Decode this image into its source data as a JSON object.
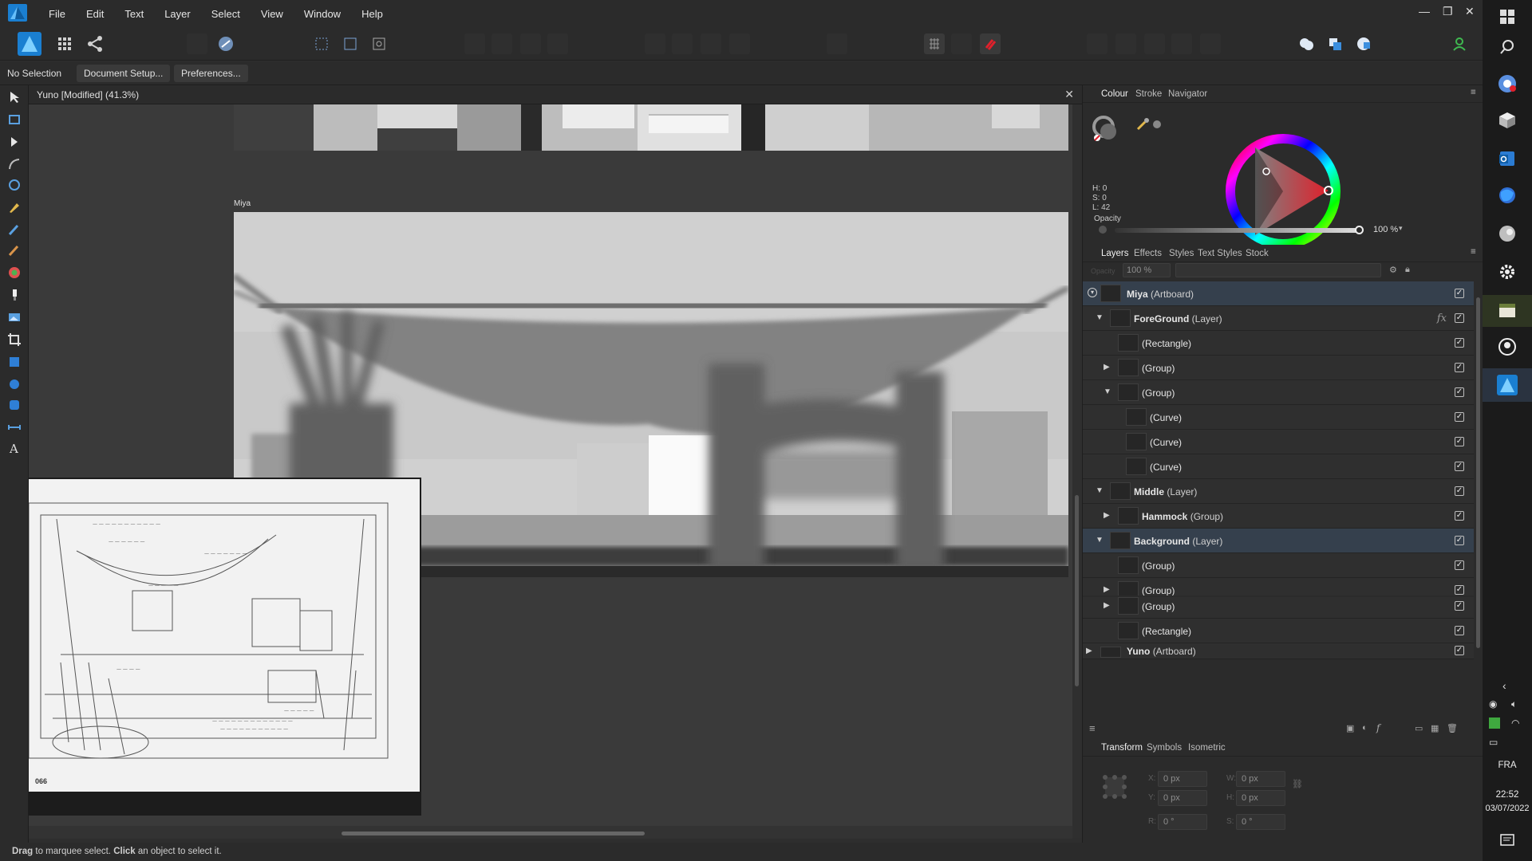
{
  "menubar": {
    "items": [
      "File",
      "Edit",
      "Text",
      "Layer",
      "Select",
      "View",
      "Window",
      "Help"
    ]
  },
  "contextbar": {
    "selection": "No Selection",
    "document_setup": "Document Setup...",
    "preferences": "Preferences..."
  },
  "document": {
    "tab_title": "Yuno [Modified] (41.3%)",
    "artboard_label": "Miya"
  },
  "colour_panel": {
    "tabs": [
      "Colour",
      "Stroke",
      "Navigator"
    ],
    "h": "H: 0",
    "s": "S: 0",
    "l": "L: 42",
    "opacity_label": "Opacity",
    "opacity_value": "100 %",
    "accent": "#e0202b"
  },
  "layers_panel": {
    "tabs": [
      "Layers",
      "Effects",
      "Styles",
      "Text Styles",
      "Stock"
    ],
    "opacity_label": "Opacity",
    "opacity_value": "100 %",
    "rows": [
      {
        "name": "Miya",
        "type": "(Artboard)"
      },
      {
        "name": "ForeGround",
        "type": "(Layer)"
      },
      {
        "name": "",
        "type": "(Rectangle)"
      },
      {
        "name": "",
        "type": "(Group)"
      },
      {
        "name": "",
        "type": "(Group)"
      },
      {
        "name": "",
        "type": "(Curve)"
      },
      {
        "name": "",
        "type": "(Curve)"
      },
      {
        "name": "",
        "type": "(Curve)"
      },
      {
        "name": "Middle",
        "type": "(Layer)"
      },
      {
        "name": "Hammock",
        "type": "(Group)"
      },
      {
        "name": "Background",
        "type": "(Layer)"
      },
      {
        "name": "",
        "type": "(Group)"
      },
      {
        "name": "",
        "type": "(Group)"
      },
      {
        "name": "",
        "type": "(Group)"
      },
      {
        "name": "",
        "type": "(Rectangle)"
      },
      {
        "name": "Yuno",
        "type": "(Artboard)"
      }
    ],
    "fx": "fx"
  },
  "transform_panel": {
    "tabs": [
      "Transform",
      "Symbols",
      "Isometric"
    ],
    "x_label": "X:",
    "x": "0 px",
    "y_label": "Y:",
    "y": "0 px",
    "w_label": "W:",
    "w": "0 px",
    "h_label": "H:",
    "h": "0 px",
    "r_label": "R:",
    "r": "0 °",
    "s_label": "S:",
    "s": "0 °"
  },
  "sketch": {
    "page_number": "066"
  },
  "statusbar": {
    "drag": "Drag",
    "text1": " to marquee select. ",
    "click": "Click",
    "text2": " an object to select it."
  },
  "taskbar": {
    "lang": "FRA",
    "time": "22:52",
    "date": "03/07/2022"
  }
}
